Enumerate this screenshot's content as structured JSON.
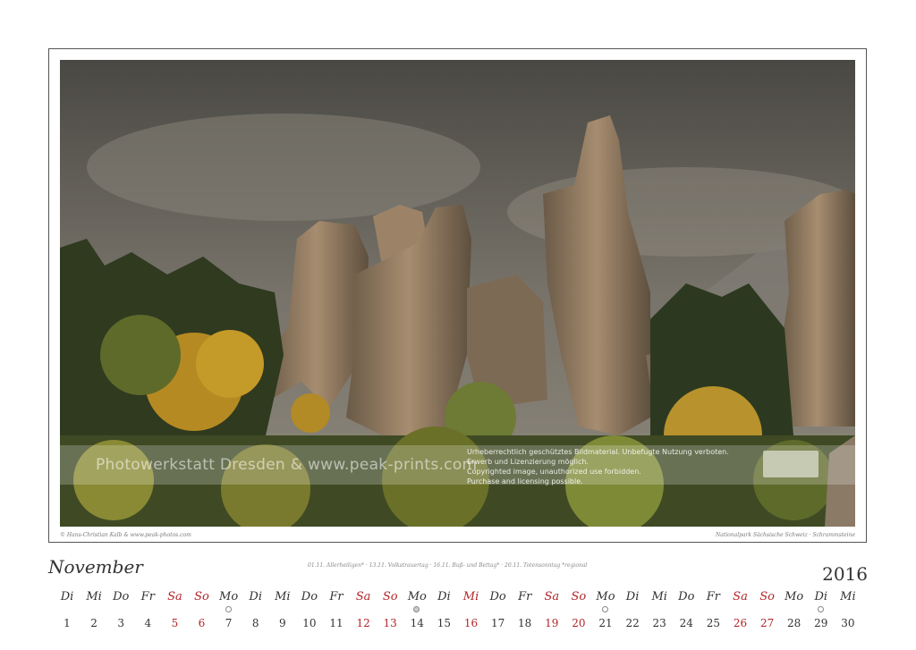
{
  "calendar": {
    "month": "November",
    "year": "2016",
    "holidays": "01.11. Allerheiligen* · 13.11. Volkstrauertag · 16.11. Buß- und Bettag* · 20.11. Totensonntag *regional",
    "credit_left": "© Hans-Christian Kalb & www.peak-photos.com",
    "credit_right": "Nationalpark Sächsische Schweiz · Schrammsteine",
    "days": [
      {
        "wd": "Di",
        "n": "1",
        "red": false
      },
      {
        "wd": "Mi",
        "n": "2",
        "red": false
      },
      {
        "wd": "Do",
        "n": "3",
        "red": false
      },
      {
        "wd": "Fr",
        "n": "4",
        "red": false
      },
      {
        "wd": "Sa",
        "n": "5",
        "red": true
      },
      {
        "wd": "So",
        "n": "6",
        "red": true
      },
      {
        "wd": "Mo",
        "n": "7",
        "red": false
      },
      {
        "wd": "Di",
        "n": "8",
        "red": false
      },
      {
        "wd": "Mi",
        "n": "9",
        "red": false
      },
      {
        "wd": "Do",
        "n": "10",
        "red": false
      },
      {
        "wd": "Fr",
        "n": "11",
        "red": false
      },
      {
        "wd": "Sa",
        "n": "12",
        "red": true
      },
      {
        "wd": "So",
        "n": "13",
        "red": true
      },
      {
        "wd": "Mo",
        "n": "14",
        "red": false
      },
      {
        "wd": "Di",
        "n": "15",
        "red": false
      },
      {
        "wd": "Mi",
        "n": "16",
        "red": true
      },
      {
        "wd": "Do",
        "n": "17",
        "red": false
      },
      {
        "wd": "Fr",
        "n": "18",
        "red": false
      },
      {
        "wd": "Sa",
        "n": "19",
        "red": true
      },
      {
        "wd": "So",
        "n": "20",
        "red": true
      },
      {
        "wd": "Mo",
        "n": "21",
        "red": false
      },
      {
        "wd": "Di",
        "n": "22",
        "red": false
      },
      {
        "wd": "Mi",
        "n": "23",
        "red": false
      },
      {
        "wd": "Do",
        "n": "24",
        "red": false
      },
      {
        "wd": "Fr",
        "n": "25",
        "red": false
      },
      {
        "wd": "Sa",
        "n": "26",
        "red": true
      },
      {
        "wd": "So",
        "n": "27",
        "red": true
      },
      {
        "wd": "Mo",
        "n": "28",
        "red": false
      },
      {
        "wd": "Di",
        "n": "29",
        "red": false
      },
      {
        "wd": "Mi",
        "n": "30",
        "red": false
      }
    ],
    "moon_phases": [
      {
        "day_index": 6,
        "type": "first-quarter"
      },
      {
        "day_index": 13,
        "type": "full"
      },
      {
        "day_index": 20,
        "type": "last-quarter"
      },
      {
        "day_index": 28,
        "type": "new"
      }
    ]
  },
  "watermark": {
    "left": "Photowerkstatt Dresden & www.peak-prints.com",
    "line1": "Urheberrechtlich geschütztes Bildmaterial. Unbefugte Nutzung verboten.",
    "line2": "Erwerb und Lizenzierung möglich.",
    "line3": "Copyrighted image, unauthorized use forbidden.",
    "line4": "Purchase and licensing possible."
  },
  "colors": {
    "weekend_red": "#b3262b",
    "text": "#333333"
  }
}
